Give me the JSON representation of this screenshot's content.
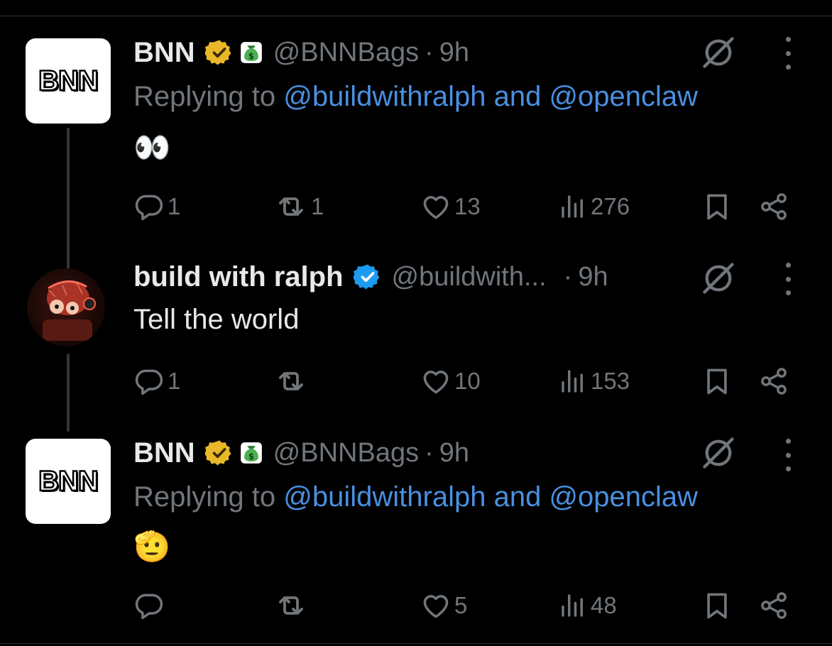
{
  "tweets": [
    {
      "author_name": "BNN",
      "handle": "@BNNBags",
      "time": "9h",
      "avatar_text": "BNN",
      "replying_prefix": "Replying to",
      "replying_user1": "@buildwithralph",
      "replying_and": "and",
      "replying_user2": "@openclaw",
      "text": "👀",
      "replies": "1",
      "reposts": "1",
      "likes": "13",
      "views": "276"
    },
    {
      "author_name": "build with ralph",
      "handle": "@buildwith...",
      "time": "9h",
      "text": "Tell the world",
      "replies": "1",
      "reposts": "",
      "likes": "10",
      "views": "153"
    },
    {
      "author_name": "BNN",
      "handle": "@BNNBags",
      "time": "9h",
      "avatar_text": "BNN",
      "replying_prefix": "Replying to",
      "replying_user1": "@buildwithralph",
      "replying_and": "and",
      "replying_user2": "@openclaw",
      "text": "🫡",
      "replies": "",
      "reposts": "",
      "likes": "5",
      "views": "48"
    }
  ],
  "separator": "·",
  "icons": {
    "verified_gold": "verified-gold-badge-icon",
    "verified_blue": "verified-blue-badge-icon",
    "money_bag": "money-bag-icon",
    "grok": "grok-icon",
    "more": "more-options-icon",
    "reply": "reply-icon",
    "repost": "repost-icon",
    "like": "heart-icon",
    "views": "views-chart-icon",
    "bookmark": "bookmark-icon",
    "share": "share-icon"
  },
  "colors": {
    "background": "#000000",
    "text_primary": "#e7e9ea",
    "text_secondary": "#71767b",
    "link": "#4a8fe0",
    "gold_badge": "#e8b829",
    "blue_badge": "#1d9bf0"
  }
}
